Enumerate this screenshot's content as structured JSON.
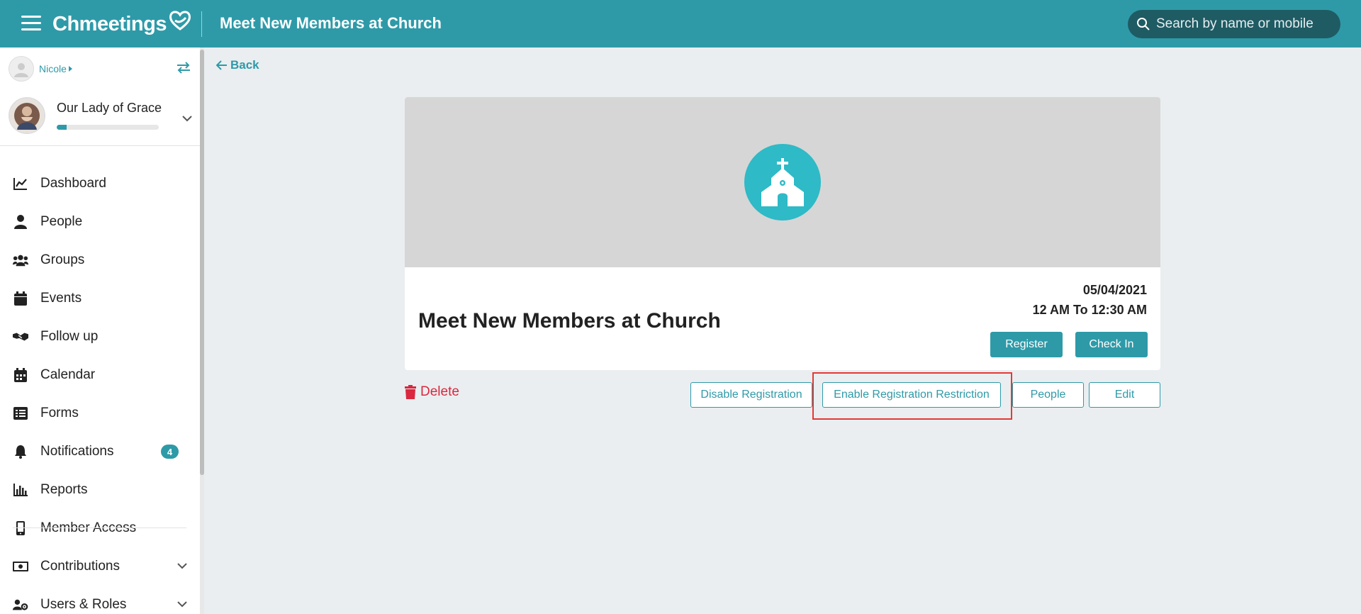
{
  "header": {
    "app_name": "Chmeetings",
    "page_title": "Meet New Members at Church",
    "search_placeholder": "Search by name or mobile"
  },
  "sidebar": {
    "user_name": "Nicole",
    "church_name": "Our Lady of Grace",
    "church_progress": 0.1,
    "items": [
      {
        "label": "Dashboard",
        "icon": "chart-line-icon"
      },
      {
        "label": "People",
        "icon": "person-icon"
      },
      {
        "label": "Groups",
        "icon": "users-icon"
      },
      {
        "label": "Events",
        "icon": "calendar-icon"
      },
      {
        "label": "Follow up",
        "icon": "handshake-icon"
      },
      {
        "label": "Calendar",
        "icon": "calendar-grid-icon"
      },
      {
        "label": "Forms",
        "icon": "list-icon"
      },
      {
        "label": "Notifications",
        "icon": "bell-icon",
        "badge": "4"
      },
      {
        "label": "Reports",
        "icon": "bar-chart-icon"
      },
      {
        "label": "Member Access",
        "icon": "mobile-icon"
      },
      {
        "label": "Contributions",
        "icon": "money-icon"
      },
      {
        "label": "Users & Roles",
        "icon": "users-cog-icon"
      }
    ]
  },
  "main": {
    "back_label": "Back",
    "event": {
      "title": "Meet New Members at Church",
      "date": "05/04/2021",
      "time": "12 AM To 12:30 AM",
      "register_label": "Register",
      "checkin_label": "Check In"
    },
    "actions": {
      "delete_label": "Delete",
      "disable_registration_label": "Disable Registration",
      "enable_restriction_label": "Enable Registration Restriction",
      "people_label": "People",
      "edit_label": "Edit"
    }
  },
  "colors": {
    "brand": "#2e9aa8",
    "danger": "#d9283f",
    "highlight": "#e53935"
  }
}
